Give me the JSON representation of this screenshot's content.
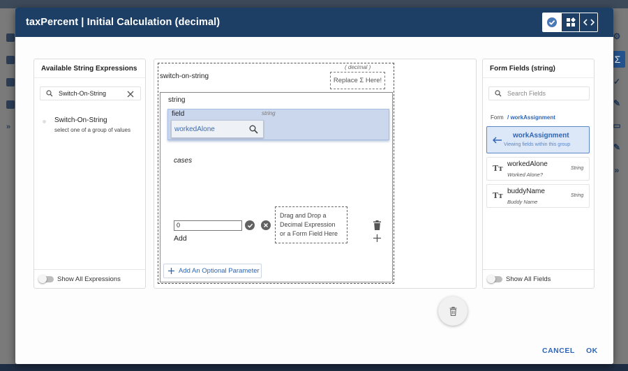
{
  "dialog": {
    "title": "taxPercent | Initial Calculation (decimal)",
    "view_toggles": [
      {
        "icon": "check-circle-icon",
        "active": true
      },
      {
        "icon": "blocks-icon",
        "active": false
      },
      {
        "icon": "code-icon",
        "active": false
      }
    ]
  },
  "left_panel": {
    "title": "Available String Expressions",
    "search_value": "Switch-On-String",
    "expressions": [
      {
        "name": "Switch-On-String",
        "description": "select one of a group of values"
      }
    ],
    "footer_toggle_label": "Show All Expressions"
  },
  "canvas": {
    "root_label": "switch-on-string",
    "return_type": "( decimal )",
    "replace_placeholder": "Replace Σ Here!",
    "string_section_label": "string",
    "field_label": "field",
    "field_type": "string",
    "field_value": "workedAlone",
    "cases_label": "cases",
    "case_input_value": "0",
    "drop_hint": "Drag and Drop a Decimal Expression or a Form Field Here",
    "add_label": "Add",
    "add_param_label": "Add An Optional Parameter"
  },
  "right_panel": {
    "title": "Form Fields (string)",
    "search_placeholder": "Search Fields",
    "breadcrumb_root": "Form",
    "breadcrumb_path": "/ workAssignment",
    "group": {
      "name": "workAssignment",
      "subtitle": "Viewing fields within this group"
    },
    "fields": [
      {
        "name": "workedAlone",
        "label": "Worked Alone?",
        "type": "String"
      },
      {
        "name": "buddyName",
        "label": "Buddy Name",
        "type": "String"
      }
    ],
    "footer_toggle_label": "Show All Fields"
  },
  "actions": {
    "cancel_label": "CANCEL",
    "ok_label": "OK"
  },
  "colors": {
    "header": "#1d3f66",
    "accent": "#2f65b5",
    "selected_group": "#dce7f7"
  }
}
